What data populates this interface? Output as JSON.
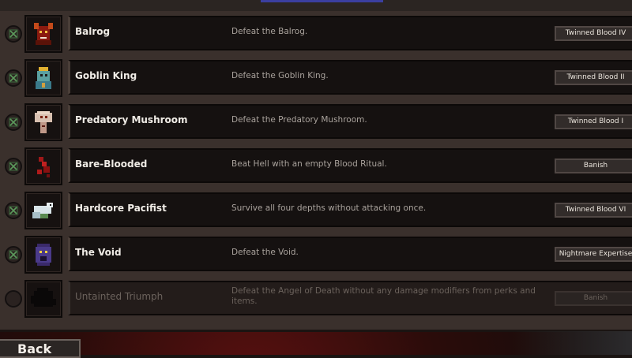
{
  "back_label": "Back",
  "colors": {
    "panel": "#3a302c",
    "entry": "#151110",
    "check": "#5c9a5c"
  },
  "achievements": [
    {
      "name": "Balrog",
      "description": "Defeat the Balrog.",
      "reward": "Twinned Blood IV",
      "completed": true,
      "icon": "balrog-icon"
    },
    {
      "name": "Goblin King",
      "description": "Defeat the Goblin King.",
      "reward": "Twinned Blood II",
      "completed": true,
      "icon": "goblin-king-icon"
    },
    {
      "name": "Predatory Mushroom",
      "description": "Defeat the Predatory Mushroom.",
      "reward": "Twinned Blood I",
      "completed": true,
      "icon": "mushroom-icon"
    },
    {
      "name": "Bare-Blooded",
      "description": "Beat Hell with an empty Blood Ritual.",
      "reward": "Banish",
      "completed": true,
      "icon": "blood-icon"
    },
    {
      "name": "Hardcore Pacifist",
      "description": "Survive all four depths without attacking once.",
      "reward": "Twinned Blood VI",
      "completed": true,
      "icon": "dove-icon"
    },
    {
      "name": "The Void",
      "description": "Defeat the Void.",
      "reward": "Nightmare Expertise",
      "completed": true,
      "icon": "void-icon"
    },
    {
      "name": "Untainted Triumph",
      "description": "Defeat the Angel of Death without any damage modifiers from perks and items.",
      "reward": "Banish",
      "completed": false,
      "icon": "locked-silhouette-icon"
    }
  ]
}
